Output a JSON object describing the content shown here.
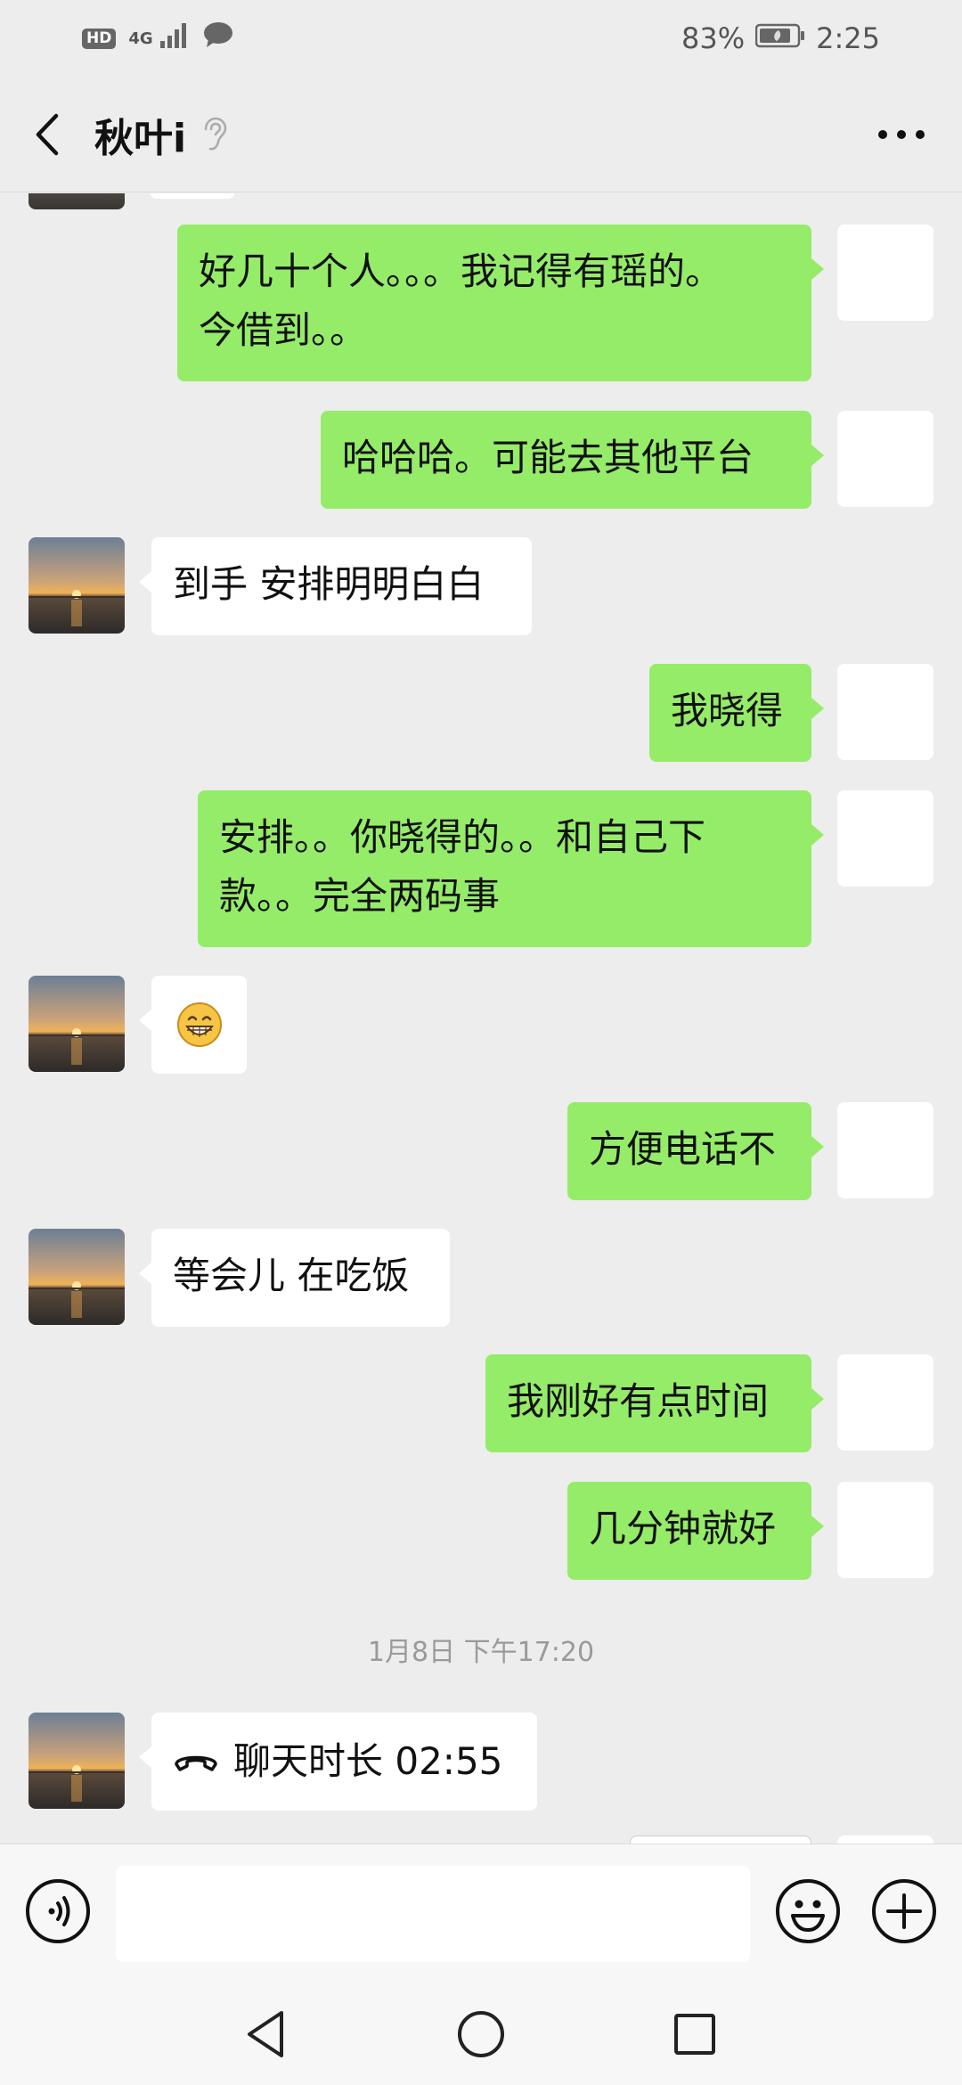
{
  "status_bar": {
    "hd": "HD",
    "network": "4G",
    "battery": "83%",
    "time": "2:25"
  },
  "header": {
    "title": "秋叶i"
  },
  "messages": [
    {
      "side": "me",
      "text": "好几十个人。。。我记得有瑶的。\n今借到。。"
    },
    {
      "side": "me",
      "text": "哈哈哈。可能去其他平台"
    },
    {
      "side": "them",
      "text": "到手 安排明明白白"
    },
    {
      "side": "me",
      "text": "我晓得"
    },
    {
      "side": "me",
      "text": "安排。。你晓得的。。和自己下\n款。。完全两码事"
    },
    {
      "side": "them",
      "text": "😁"
    },
    {
      "side": "me",
      "text": "方便电话不"
    },
    {
      "side": "them",
      "text": "等会儿 在吃饭"
    },
    {
      "side": "me",
      "text": "我刚好有点时间"
    },
    {
      "side": "me",
      "text": "几分钟就好"
    },
    {
      "side": "them",
      "text": "聊天时长 02:55"
    }
  ],
  "timestamp": "1月8日 下午17:20",
  "colors": {
    "background": "#EDEDED",
    "my_bubble": "#95EC69",
    "their_bubble": "#FFFFFF"
  },
  "icons": {
    "back": "chevron-left-icon",
    "ear": "ear-icon",
    "more": "more-dots-icon",
    "call": "phone-hangup-icon",
    "voice": "voice-icon",
    "emoji": "emoji-icon",
    "plus": "plus-icon"
  }
}
